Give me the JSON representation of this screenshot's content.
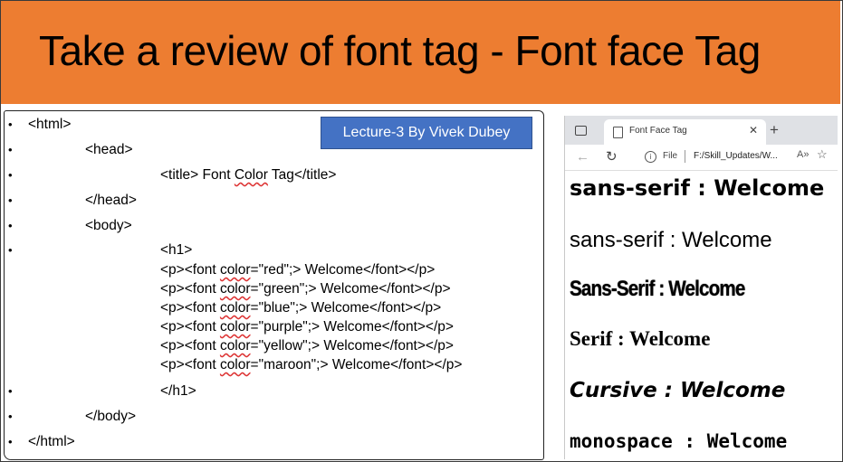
{
  "banner": {
    "title": "Take a review of font tag - Font face Tag"
  },
  "badge": {
    "text": "Lecture-3 By Vivek Dubey"
  },
  "code": {
    "html_open": "<html>",
    "head_open": "<head>",
    "title_open": "<title> Font ",
    "title_word": "Color",
    "title_close": " Tag</title>",
    "head_close": "</head>",
    "body_open": "<body>",
    "h1_open": "<h1>",
    "p_lines": [
      {
        "pre": "<p><font ",
        "attr": "color",
        "post": "=\"red\";> Welcome</font></p>"
      },
      {
        "pre": "<p><font ",
        "attr": "color",
        "post": "=\"green\";> Welcome</font></p>"
      },
      {
        "pre": "<p><font ",
        "attr": "color",
        "post": "=\"blue\";> Welcome</font></p>"
      },
      {
        "pre": "<p><font ",
        "attr": "color",
        "post": "=\"purple\";> Welcome</font></p>"
      },
      {
        "pre": "<p><font ",
        "attr": "color",
        "post": "=\"yellow\";> Welcome</font></p>"
      },
      {
        "pre": "<p><font ",
        "attr": "color",
        "post": "=\"maroon\";> Welcome</font></p>"
      }
    ],
    "h1_close": "</h1>",
    "body_close": "</body>",
    "html_close": "</html>",
    "bullet": "•"
  },
  "browser": {
    "tab_title": "Font Face Tag",
    "tab_close": "✕",
    "new_tab": "+",
    "back": "←",
    "refresh": "↻",
    "info": "i",
    "file_label": "File",
    "url": "F:/Skill_Updates/W...",
    "read_aloud": "A»",
    "favorites": "☆",
    "page_lines": [
      "sans-serif : Welcome",
      "sans-serif : Welcome",
      "Sans-Serif : Welcome",
      "Serif : Welcome",
      "Cursive : Welcome",
      "monospace : Welcome"
    ]
  },
  "colors": {
    "banner": "#ed7d31",
    "badge": "#4472c4"
  }
}
